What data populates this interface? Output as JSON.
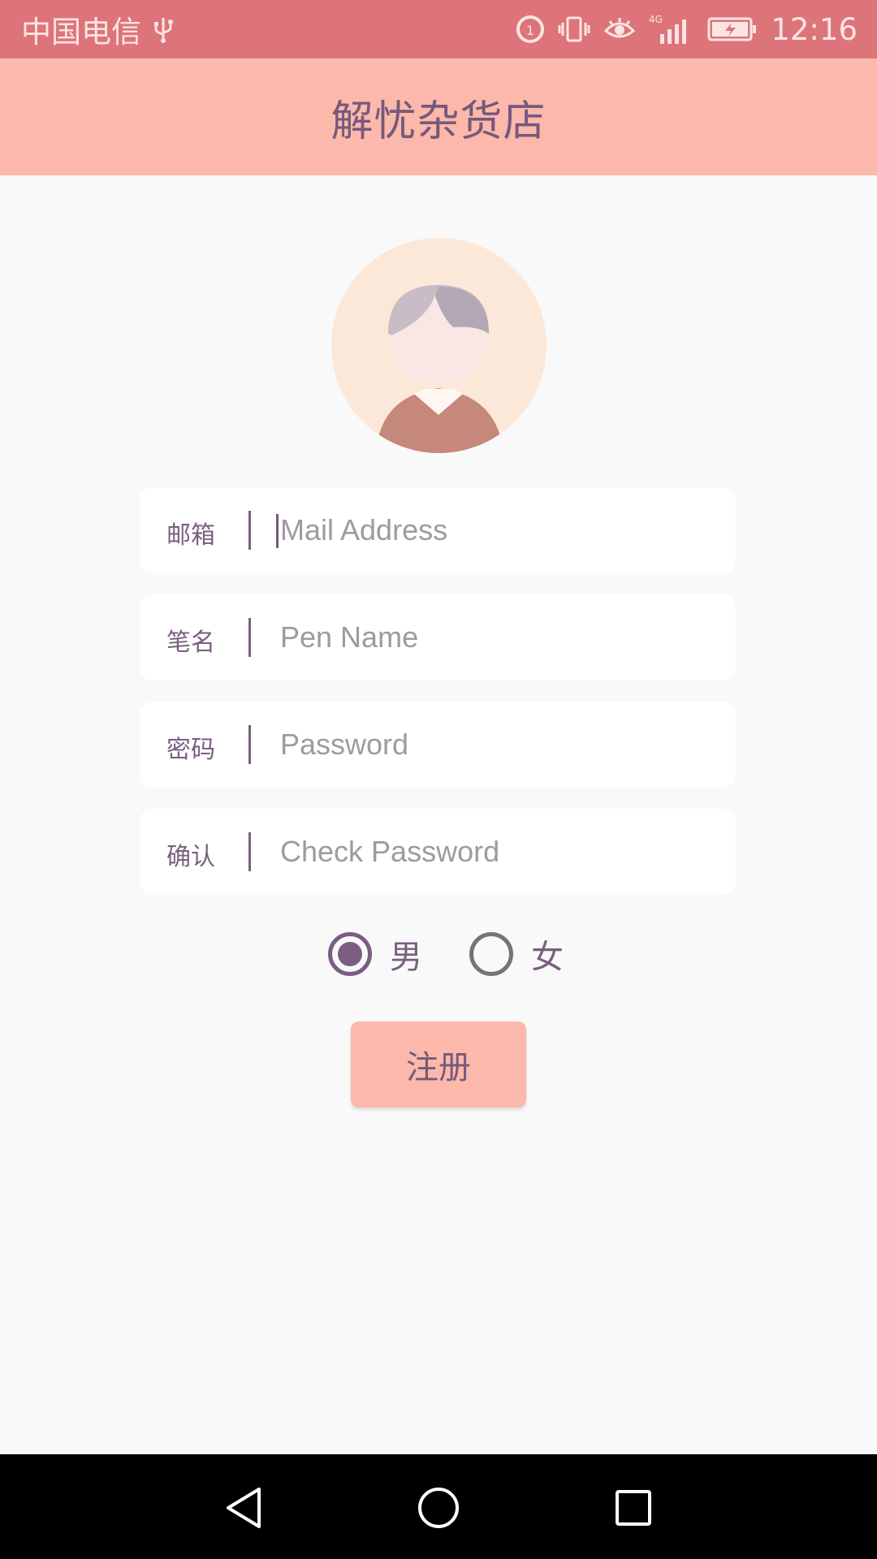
{
  "status_bar": {
    "carrier": "中国电信",
    "network": "4G",
    "time": "12:16"
  },
  "app_bar": {
    "title": "解忧杂货店"
  },
  "form": {
    "fields": [
      {
        "label": "邮箱",
        "placeholder": "Mail Address",
        "value": ""
      },
      {
        "label": "笔名",
        "placeholder": "Pen Name",
        "value": ""
      },
      {
        "label": "密码",
        "placeholder": "Password",
        "value": ""
      },
      {
        "label": "确认",
        "placeholder": "Check Password",
        "value": ""
      }
    ],
    "gender": {
      "options": [
        {
          "label": "男",
          "checked": true
        },
        {
          "label": "女",
          "checked": false
        }
      ]
    },
    "register_label": "注册"
  },
  "colors": {
    "status_bar": "#dd7479",
    "app_bar": "#fcb8aa",
    "accent": "#7b5d82",
    "background": "#f9f9fa"
  },
  "icons": {
    "status": [
      "usb-icon",
      "data-saver-icon",
      "vibrate-icon",
      "eye-comfort-icon",
      "signal-icon",
      "battery-charging-icon"
    ],
    "nav": [
      "back-icon",
      "home-icon",
      "recents-icon"
    ]
  }
}
